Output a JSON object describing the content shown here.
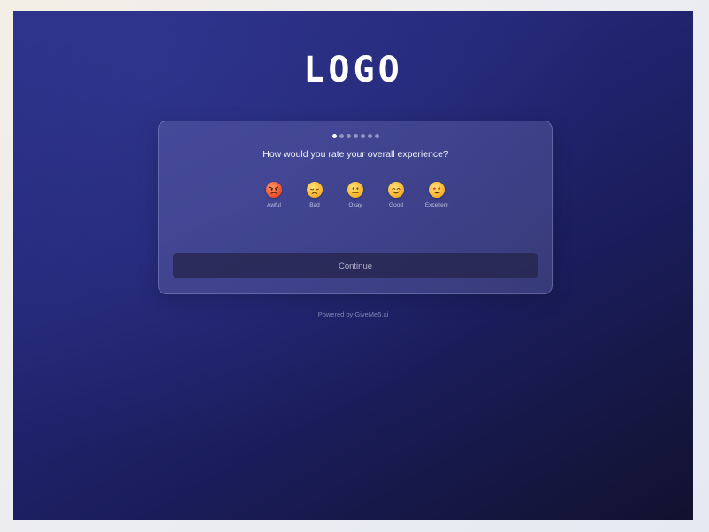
{
  "logo": {
    "text": "LOGO"
  },
  "progress": {
    "total_steps": 7,
    "current_step": 1
  },
  "question": "How would you rate your overall experience?",
  "ratings": [
    {
      "label": "Awful",
      "icon": "angry-face-icon"
    },
    {
      "label": "Bad",
      "icon": "disappointed-face-icon"
    },
    {
      "label": "Okay",
      "icon": "neutral-face-icon"
    },
    {
      "label": "Good",
      "icon": "smiling-face-icon"
    },
    {
      "label": "Excellent",
      "icon": "star-struck-face-icon"
    }
  ],
  "continue_label": "Continue",
  "powered_by": "Powered by GiveMe5.ai",
  "colors": {
    "background_start": "#2a2f85",
    "background_end": "#11122e",
    "card": "#5a5e9e",
    "button": "#232346"
  }
}
